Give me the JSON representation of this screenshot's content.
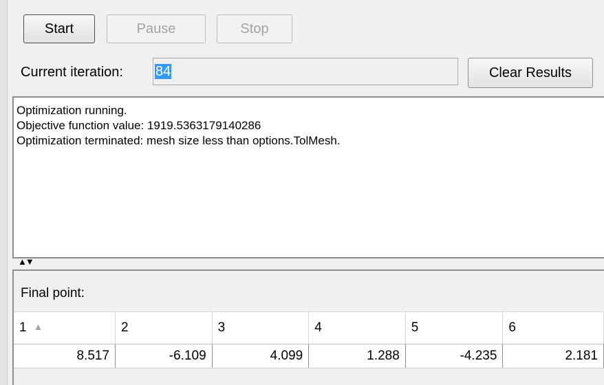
{
  "toolbar": {
    "start_label": "Start",
    "pause_label": "Pause",
    "stop_label": "Stop"
  },
  "iteration": {
    "label": "Current iteration:",
    "value": "84"
  },
  "clear_label": "Clear Results",
  "log": {
    "lines": [
      "Optimization running.",
      "Objective function value: 1919.5363179140286",
      "Optimization terminated: mesh size less than options.TolMesh."
    ]
  },
  "splitter_glyphs": "▲▼",
  "final_point": {
    "title": "Final point:",
    "columns": [
      "1",
      "2",
      "3",
      "4",
      "5",
      "6"
    ],
    "sort_glyph": "▲",
    "values": [
      "8.517",
      "-6.109",
      "4.099",
      "1.288",
      "-4.235",
      "2.181"
    ]
  }
}
